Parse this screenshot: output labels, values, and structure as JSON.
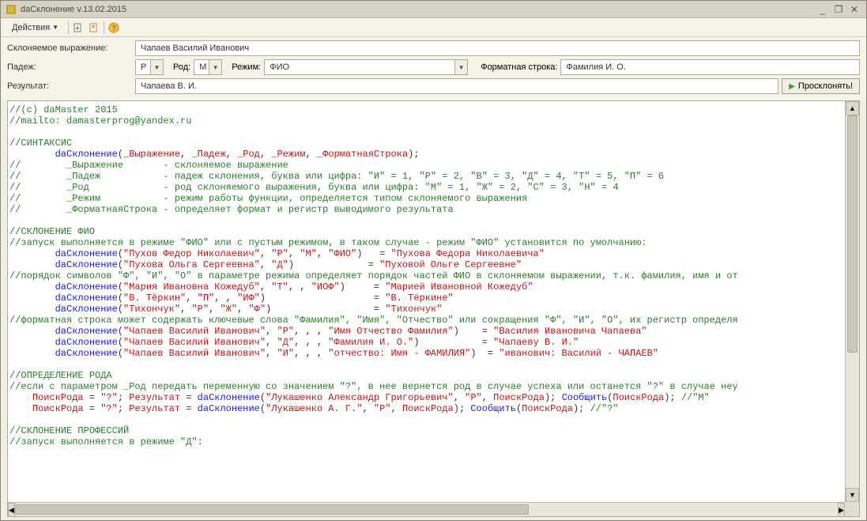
{
  "window": {
    "title": "daСклонение v.13.02.2015",
    "minimize": "_",
    "restore": "❐",
    "close": "✕"
  },
  "toolbar": {
    "actions_label": "Действия"
  },
  "form": {
    "expr_label": "Склоняемое выражение:",
    "expr_value": "Чапаев Василий Иванович",
    "padezh_label": "Падеж:",
    "padezh_value": "Р",
    "rod_label": "Род:",
    "rod_value": "М",
    "mode_label": "Режим:",
    "mode_value": "ФИО",
    "format_label": "Форматная строка:",
    "format_value": "Фамилия И. О.",
    "result_label": "Результат:",
    "result_value": "Чапаева В. И.",
    "run_label": "Просклонять!"
  },
  "code": {
    "l1": "//(c) daMaster 2015",
    "l2": "//mailto: damasterprog@yandex.ru",
    "l3": "//СИНТАКСИС",
    "l4a": "daСклонение",
    "l4b": "_Выражение",
    "l4c": "_Падеж",
    "l4d": "_Род",
    "l4e": "_Режим",
    "l4f": "_ФорматнаяСтрока",
    "l5": "//        _Выражение       - склоняемое выражение",
    "l6": "//        _Падеж           - падеж склонения, буква или цифра: \"И\" = 1, \"Р\" = 2, \"В\" = 3, \"Д\" = 4, \"Т\" = 5, \"П\" = 6",
    "l7": "//        _Род             - род склоняемого выражения, буква или цифра: \"М\" = 1, \"Ж\" = 2, \"С\" = 3, \"Н\" = 4",
    "l8": "//        _Режим           - режим работы функции, определяется типом склоняемого выражения",
    "l9": "//        _ФорматнаяСтрока - определяет формат и регистр выводимого результата",
    "l10": "//СКЛОНЕНИЕ ФИО",
    "l11": "//запуск выполняется в режиме \"ФИО\" или с пустым режимом, в таком случае - режим \"ФИО\" установится по умолчанию:",
    "s1": "\"Пухов Федор Николаевич\"",
    "s1p": "\"Р\"",
    "s1r": "\"М\"",
    "s1m": "\"ФИО\"",
    "s1res": "\"Пухова Федора Николаевича\"",
    "s2": "\"Пухова Ольга Сергеевна\"",
    "s2p": "\"Д\"",
    "s2res": "\"Пуховой Ольге Сергеевне\"",
    "l12": "//порядок символов \"Ф\", \"И\", \"О\" в параметре режима определяет порядок частей ФИО в склоняемом выражении, т.к. фамилия, имя и от",
    "s3": "\"Мария Ивановна Кожедуб\"",
    "s3p": "\"Т\"",
    "s3m": "\"ИОФ\"",
    "s3res": "\"Марией Ивановной Кожедуб\"",
    "s4": "\"В. Тёркин\"",
    "s4p": "\"П\"",
    "s4m": "\"ИФ\"",
    "s4res": "\"В. Тёркине\"",
    "s5": "\"Тихончук\"",
    "s5p": "\"Р\"",
    "s5r": "\"Ж\"",
    "s5m": "\"Ф\"",
    "s5res": "\"Тихончук\"",
    "l13": "//форматная строка может содержать ключевые слова \"Фамилия\", \"Имя\", \"Отчество\" или сокращения \"Ф\", \"И\", \"О\", их регистр определя",
    "s6": "\"Чапаев Василий Иванович\"",
    "s6p": "\"Р\"",
    "s6f": "\"Имя Отчество Фамилия\"",
    "s6res": "\"Василия Ивановича Чапаева\"",
    "s7": "\"Чапаев Василий Иванович\"",
    "s7p": "\"Д\"",
    "s7f": "\"Фамилия И. О.\"",
    "s7res": "\"Чапаеву В. И.\"",
    "s8": "\"Чапаев Василий Иванович\"",
    "s8p": "\"И\"",
    "s8f": "\"отчество: Имя - ФАМИЛИЯ\"",
    "s8res": "\"иванович: Василий - ЧАПАЕВ\"",
    "l14": "//ОПРЕДЕЛЕНИЕ РОДА",
    "l15": "//если с параметром _Род передать переменную со значением \"?\", в нее вернется род в случае успеха или останется \"?\" в случае неу",
    "pr": "ПоискРода",
    "q": "\"?\"",
    "rez": "Результат",
    "s9": "\"Лукашенко Александр Григорьевич\"",
    "s9p": "\"Р\"",
    "soob": "Сообщить",
    "cmM": "//\"М\"",
    "cm2": "//\"?\"",
    "s10": "\"Лукашенко А. Г.\"",
    "s10p": "\"Р\"",
    "l16": "//СКЛОНЕНИЕ ПРОФЕССИЙ",
    "l17": "//запуск выполняется в режиме \"Д\":"
  }
}
